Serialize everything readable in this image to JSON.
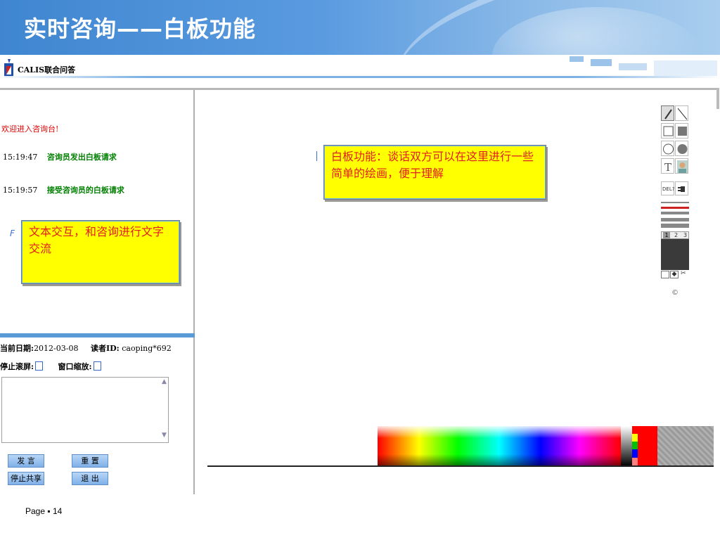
{
  "slide": {
    "title": "实时咨询——白板功能",
    "footer": "Page ▪ 14"
  },
  "app": {
    "name": "CALIS联合问答",
    "logo_icon": "calis-logo-icon"
  },
  "chat": {
    "welcome": "欢迎进入咨询台!",
    "messages": [
      {
        "time": "15:19:47",
        "text": "咨询员发出白板请求"
      },
      {
        "time": "15:19:57",
        "text": "接受咨询员的白板请求"
      }
    ]
  },
  "annotations": {
    "text_interaction": "文本交互，和咨询进行文字交流",
    "whiteboard": "白板功能：谈话双方可以在这里进行一些简单的绘画，便于理解"
  },
  "info": {
    "date_label": "当前日期:",
    "date_value": "2012-03-08",
    "reader_label": "读者ID:",
    "reader_value": "caoping*692",
    "stop_scroll_label": "停止滚屏:",
    "window_zoom_label": "窗口缩放:"
  },
  "buttons": {
    "send": "发 言",
    "reset": "重 置",
    "stop_share": "停止共享",
    "exit": "退 出"
  },
  "toolbox": {
    "del_label": "DEL?",
    "pages": [
      "1",
      "2",
      "3"
    ],
    "copyright": "©",
    "tools": [
      "pencil-icon",
      "line-icon",
      "rect-outline-icon",
      "rect-filled-icon",
      "circle-outline-icon",
      "circle-filled-icon",
      "text-tool-icon",
      "image-tool-icon"
    ]
  },
  "palette": {
    "current_color": "#ff0000",
    "swatches": [
      "#ff0000",
      "#ffff00",
      "#00c000",
      "#0000ff",
      "#ff8080"
    ]
  },
  "colors": {
    "banner": "#4a8fd8",
    "callout_bg": "#ffff00",
    "callout_text": "#e02020",
    "chat_time": "#000000",
    "chat_msg": "#008000",
    "welcome": "#e00000"
  }
}
